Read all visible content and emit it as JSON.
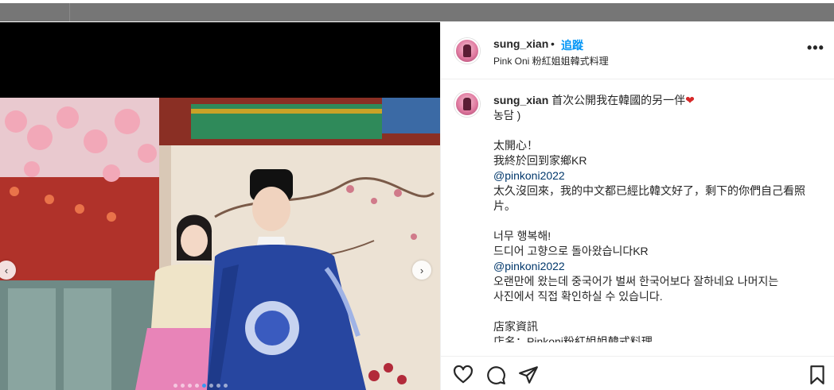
{
  "colors": {
    "follow": "#0095f6",
    "mention": "#00376b",
    "text": "#262626",
    "heart": "#d62828",
    "active_dot": "#3897f0"
  },
  "post": {
    "username": "sung_xian",
    "separator": "•",
    "follow_label": "追蹤",
    "location": "Pink Oni 粉紅姐姐韓式料理",
    "more_icon": "more-horizontal-icon",
    "carousel": {
      "prev_icon": "chevron-left-icon",
      "next_icon": "chevron-right-icon",
      "prev_glyph": "‹",
      "next_glyph": "›",
      "slide_count": 8,
      "active_index": 4
    }
  },
  "caption": {
    "username": "sung_xian",
    "first_line": "首次公開我在韓國的另一伴",
    "heart_emoji": "❤",
    "lines": [
      "농담 )",
      "",
      "太開心！",
      "我終於回到家鄉KR",
      "@pinkoni2022",
      "太久沒回來，我的中文都已經比韓文好了，剩下的你們自己看照",
      "片。",
      "",
      "너무 행복해!",
      "드디어 고향으로 돌아왔습니다KR",
      "@pinkoni2022",
      "오랜만에 왔는데 중국어가 벌써 한국어보다 잘하네요 나머지는",
      "사진에서 직접 확인하실 수 있습니다.",
      "",
      "店家資訊",
      "店名：Pinkoni粉紅姐姐韓式料理"
    ]
  },
  "actions": {
    "like_icon": "heart-icon",
    "comment_icon": "comment-icon",
    "share_icon": "share-icon",
    "save_icon": "bookmark-icon"
  }
}
